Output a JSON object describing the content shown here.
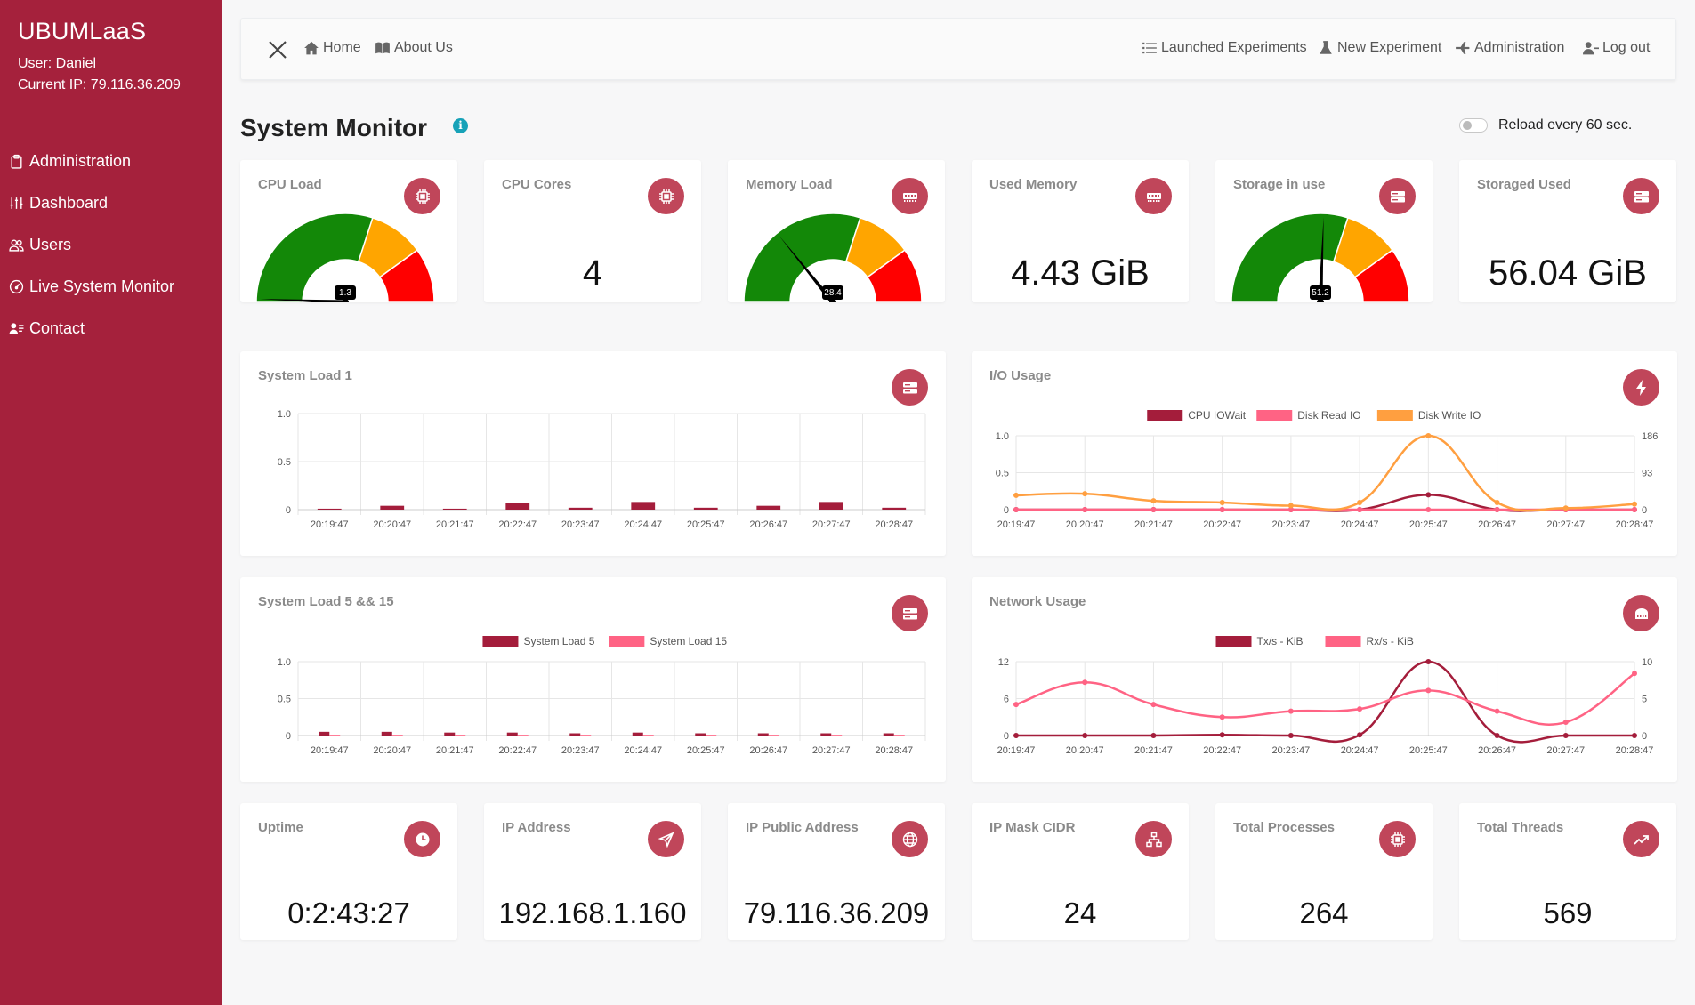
{
  "sidebar": {
    "brand": "UBUMLaaS",
    "user": "User: Daniel",
    "current_ip": "Current IP: 79.116.36.209",
    "items": [
      {
        "label": "Administration",
        "icon": "clipboard-icon"
      },
      {
        "label": "Dashboard",
        "icon": "sliders-icon"
      },
      {
        "label": "Users",
        "icon": "users-icon"
      },
      {
        "label": "Live System Monitor",
        "icon": "gauge-icon"
      },
      {
        "label": "Contact",
        "icon": "contact-icon"
      }
    ]
  },
  "topbar": {
    "home": "Home",
    "about": "About Us",
    "launched": "Launched Experiments",
    "new_experiment": "New Experiment",
    "administration": "Administration",
    "logout": "Log out"
  },
  "page": {
    "title": "System Monitor",
    "info": "i",
    "reload_label": "Reload every 60 sec."
  },
  "colors": {
    "sidebar": "#a5213c",
    "accent": "#c0465a",
    "green": "#138808",
    "orange": "#ffa500",
    "red": "#ff0000",
    "series_dark": "#a41d3b",
    "series_pink": "#ff6384",
    "series_orange": "#ff9f40"
  },
  "stats_top": [
    {
      "label": "CPU Load",
      "icon": "cpu-icon",
      "type": "gauge",
      "gauge_value": 1.3
    },
    {
      "label": "CPU Cores",
      "icon": "cpu-icon",
      "type": "value",
      "value": "4"
    },
    {
      "label": "Memory Load",
      "icon": "memory-icon",
      "type": "gauge",
      "gauge_value": 28.4
    },
    {
      "label": "Used Memory",
      "icon": "memory-icon",
      "type": "value",
      "value": "4.43 GiB"
    },
    {
      "label": "Storage in use",
      "icon": "hdd-icon",
      "type": "gauge",
      "gauge_value": 51.2
    },
    {
      "label": "Storaged Used",
      "icon": "hdd-icon",
      "type": "value",
      "value": "56.04 GiB"
    }
  ],
  "stats_bottom": [
    {
      "label": "Uptime",
      "icon": "clock-icon",
      "value": "0:2:43:27"
    },
    {
      "label": "IP Address",
      "icon": "send-icon",
      "value": "192.168.1.160"
    },
    {
      "label": "IP Public Address",
      "icon": "globe-icon",
      "value": "79.116.36.209"
    },
    {
      "label": "IP Mask CIDR",
      "icon": "network-icon",
      "value": "24"
    },
    {
      "label": "Total Processes",
      "icon": "cpu-icon",
      "value": "264"
    },
    {
      "label": "Total Threads",
      "icon": "trend-icon",
      "value": "569"
    }
  ],
  "chart_data": [
    {
      "title": "System Load 1",
      "icon": "server-icon",
      "type": "bar",
      "categories": [
        "20:19:47",
        "20:20:47",
        "20:21:47",
        "20:22:47",
        "20:23:47",
        "20:24:47",
        "20:25:47",
        "20:26:47",
        "20:27:47",
        "20:28:47"
      ],
      "series": [
        {
          "values": [
            0.01,
            0.04,
            0.01,
            0.07,
            0.02,
            0.08,
            0.02,
            0.04,
            0.08,
            0.02
          ]
        }
      ],
      "ylim": [
        0,
        1
      ],
      "yticks": [
        "0",
        "0.5",
        "1.0"
      ],
      "legend": "none"
    },
    {
      "title": "I/O Usage",
      "icon": "bolt-icon",
      "type": "line",
      "categories": [
        "20:19:47",
        "20:20:47",
        "20:21:47",
        "20:22:47",
        "20:23:47",
        "20:24:47",
        "20:25:47",
        "20:26:47",
        "20:27:47",
        "20:28:47"
      ],
      "series": [
        {
          "name": "CPU IOWait",
          "axis": "left",
          "values": [
            0,
            0,
            0,
            0,
            0,
            0,
            0.2,
            0,
            0,
            0
          ]
        },
        {
          "name": "Disk Read IO",
          "axis": "right",
          "values": [
            0,
            0,
            0,
            0,
            0,
            0,
            0,
            0,
            0,
            0
          ]
        },
        {
          "name": "Disk Write IO",
          "axis": "right",
          "values": [
            36,
            40,
            22,
            18,
            10,
            18,
            186,
            18,
            4,
            14
          ]
        }
      ],
      "ylim": [
        0,
        1
      ],
      "yticks": [
        "0",
        "0.5",
        "1.0"
      ],
      "y2lim": [
        0,
        186
      ],
      "y2ticks": [
        "0",
        "93",
        "186"
      ],
      "legend": "top"
    },
    {
      "title": "System Load 5 && 15",
      "icon": "server-icon",
      "type": "bar",
      "categories": [
        "20:19:47",
        "20:20:47",
        "20:21:47",
        "20:22:47",
        "20:23:47",
        "20:24:47",
        "20:25:47",
        "20:26:47",
        "20:27:47",
        "20:28:47"
      ],
      "series": [
        {
          "name": "System Load 5",
          "values": [
            0.05,
            0.05,
            0.04,
            0.04,
            0.03,
            0.04,
            0.03,
            0.03,
            0.03,
            0.03
          ]
        },
        {
          "name": "System Load 15",
          "values": [
            0.01,
            0.01,
            0.01,
            0.01,
            0.01,
            0.01,
            0.01,
            0.01,
            0.01,
            0.01
          ]
        }
      ],
      "ylim": [
        0,
        1
      ],
      "yticks": [
        "0",
        "0.5",
        "1.0"
      ],
      "legend": "top"
    },
    {
      "title": "Network Usage",
      "icon": "ethernet-icon",
      "type": "line",
      "categories": [
        "20:19:47",
        "20:20:47",
        "20:21:47",
        "20:22:47",
        "20:23:47",
        "20:24:47",
        "20:25:47",
        "20:26:47",
        "20:27:47",
        "20:28:47"
      ],
      "series": [
        {
          "name": "Tx/s - KiB",
          "axis": "left",
          "values": [
            0,
            0,
            0,
            0.1,
            0,
            0.1,
            12,
            0,
            0,
            0
          ]
        },
        {
          "name": "Rx/s - KiB",
          "axis": "right",
          "values": [
            4.2,
            7.2,
            4.2,
            2.5,
            3.3,
            3.6,
            6.1,
            3.3,
            1.8,
            8.4
          ]
        }
      ],
      "ylim": [
        0,
        12
      ],
      "yticks": [
        "0",
        "6",
        "12"
      ],
      "y2lim": [
        0,
        10
      ],
      "y2ticks": [
        "0",
        "5",
        "10"
      ],
      "legend": "top"
    }
  ]
}
